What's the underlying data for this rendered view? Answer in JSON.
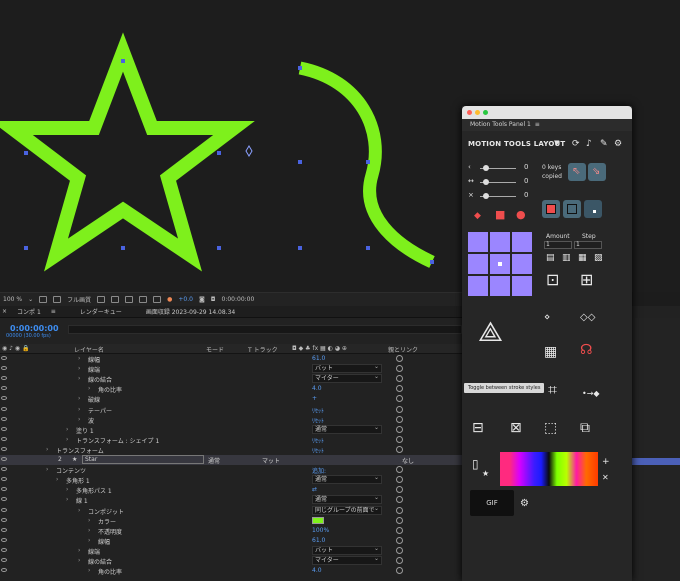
{
  "viewer_toolbar": {
    "zoom": "100 %",
    "quality": "フル画質",
    "exposure": "+0.0",
    "timecode": "0:00:00:00"
  },
  "timeline": {
    "tabs": [
      "コンポ 1",
      "レンダーキュー",
      "画面収録 2023-09-29 14.08.34"
    ],
    "current_time": "0:00:00:00",
    "fps": "00000 (30.00 fps)",
    "ruler_label": "01s",
    "headers": {
      "layer_name": "レイヤー名",
      "mode": "モード",
      "track": "T トラック",
      "parent": "親とリンク"
    },
    "rows": [
      {
        "name": "線幅",
        "value": "61.0",
        "indent": 88
      },
      {
        "name": "線端",
        "drop": "バット",
        "indent": 88
      },
      {
        "name": "線の結合",
        "drop": "マイター",
        "indent": 88
      },
      {
        "name": "角の比率",
        "value": "4.0",
        "indent": 98
      },
      {
        "name": "破線",
        "value": "+",
        "indent": 88
      },
      {
        "name": "テーパー",
        "value": "ﾘｾｯﾄ",
        "indent": 88
      },
      {
        "name": "波",
        "value": "ﾘｾｯﾄ",
        "indent": 88
      },
      {
        "name": "塗り 1",
        "drop": "通常",
        "indent": 76
      },
      {
        "name": "トランスフォーム : シェイプ 1",
        "value": "ﾘｾｯﾄ",
        "indent": 76
      },
      {
        "name": "トランスフォーム",
        "value": "ﾘｾｯﾄ",
        "indent": 56
      },
      {
        "name": "Star",
        "layer": true,
        "number": "2",
        "mode": "通常",
        "matte": "マット",
        "parent": "なし"
      },
      {
        "name": "コンテンツ",
        "value": "追加:",
        "indent": 56
      },
      {
        "name": "多角形 1",
        "drop": "通常",
        "indent": 66
      },
      {
        "name": "多角形パス 1",
        "value": "⇄",
        "indent": 76
      },
      {
        "name": "線 1",
        "drop": "通常",
        "indent": 76
      },
      {
        "name": "コンポジット",
        "drop": "同じグループの前面で",
        "indent": 88
      },
      {
        "name": "カラー",
        "value": "",
        "indent": 98,
        "swatch": "#7ef01c"
      },
      {
        "name": "不透明度",
        "value": "100%",
        "indent": 98
      },
      {
        "name": "線幅",
        "value": "61.0",
        "indent": 98
      },
      {
        "name": "線端",
        "drop": "バット",
        "indent": 88
      },
      {
        "name": "線の結合",
        "drop": "マイター",
        "indent": 88
      },
      {
        "name": "角の比率",
        "value": "4.0",
        "indent": 98
      }
    ]
  },
  "panel": {
    "tab_label": "Motion Tools Panel 1",
    "title": "MOTION TOOLS LAYOUT",
    "sliders": [
      {
        "symbol": "‹",
        "value": "0"
      },
      {
        "symbol": "↔",
        "value": "0"
      },
      {
        "symbol": "⨯",
        "value": "0"
      }
    ],
    "keys_label": "0 keys",
    "copied_label": "copied",
    "amount_label": "Amount",
    "step_label": "Step",
    "amount_value": "1",
    "step_value": "1",
    "tooltip": "Toggle between stroke styles",
    "gif_label": "GIF",
    "colors": {
      "accent": "#9b86ff",
      "red": "#ef4d4d",
      "stroke_green": "#7ef01c"
    }
  }
}
